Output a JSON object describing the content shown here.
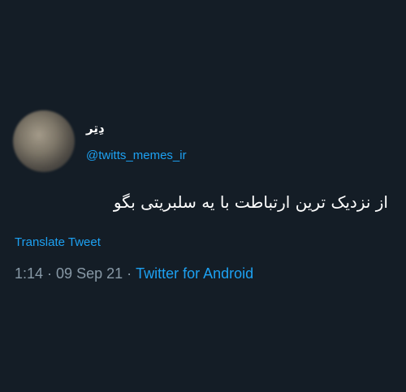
{
  "tweet": {
    "author": {
      "display_name": "دِتِر",
      "handle": "@twitts_memes_ir",
      "avatar_icon": "blurred-avatar"
    },
    "text": "از نزدیک ترین ارتباطت با یه سلبریتی بگو",
    "translate_label": "Translate Tweet",
    "time": "1:14",
    "date": "09 Sep 21",
    "separator": "·",
    "source": "Twitter for Android"
  },
  "colors": {
    "background": "#141d26",
    "text": "#ffffff",
    "link": "#1da1f2",
    "secondary": "#8899a6"
  }
}
